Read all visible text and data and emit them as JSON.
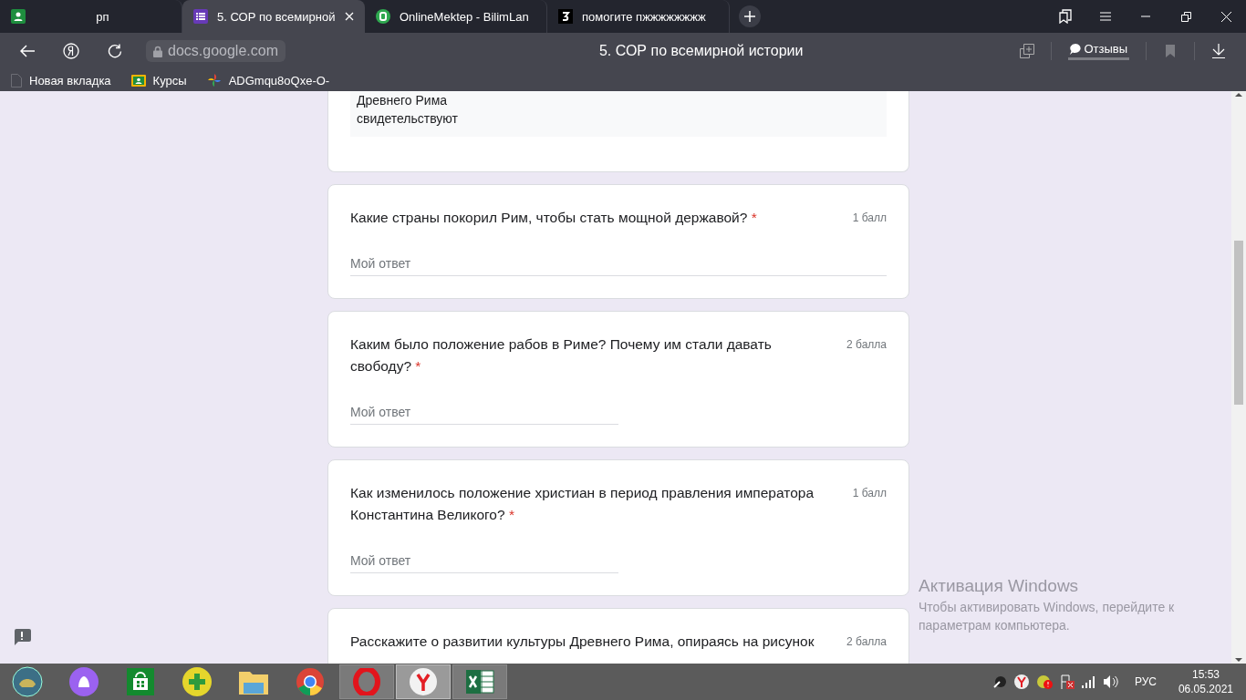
{
  "tabs": [
    {
      "title": "рп",
      "kind": "person",
      "selected": false
    },
    {
      "title": "5. СОР по всемирной",
      "kind": "list",
      "selected": true
    },
    {
      "title": "OnlineMektep - BilimLan",
      "kind": "greencircle",
      "selected": false
    },
    {
      "title": "помогите пжжжжжжжж",
      "kind": "blacksquare",
      "selected": false
    }
  ],
  "address": {
    "url": "docs.google.com",
    "page_title": "5. СОР по всемирной истории",
    "feedback": "Отзывы"
  },
  "bookmarks": [
    {
      "label": "Новая вкладка",
      "kind": "page"
    },
    {
      "label": "Курсы",
      "kind": "classroom"
    },
    {
      "label": "ADGmqu8oQxe-O-",
      "kind": "pinwheel"
    }
  ],
  "previous_answer": [
    "Древнего Рима",
    "свидетельствуют"
  ],
  "questions": [
    {
      "title": "Какие страны покорил Рим, чтобы стать мощной державой?",
      "required_mark": "*",
      "points": "1 балл",
      "placeholder": "Мой ответ",
      "kind": "wide"
    },
    {
      "title": "Каким было положение рабов в Риме? Почему им стали давать свободу?",
      "required_mark": "*",
      "points": "2 балла",
      "placeholder": "Мой ответ",
      "kind": "half"
    },
    {
      "title": "Как изменилось положение христиан в период правления императора Константина Великого?",
      "required_mark": "*",
      "points": "1 балл",
      "placeholder": "Мой ответ",
      "kind": "half"
    },
    {
      "title": "Расскажите о развитии культуры Древнего Рима, опираясь на рисунок",
      "points": "2 балла"
    }
  ],
  "activation": {
    "title": "Активация Windows",
    "text": "Чтобы активировать Windows, перейдите к параметрам компьютера."
  },
  "taskbar": {
    "apps": [
      {
        "kind": "start",
        "running": false,
        "selected": false
      },
      {
        "kind": "alice",
        "running": false,
        "selected": false
      },
      {
        "kind": "store",
        "running": false,
        "selected": false
      },
      {
        "kind": "plus",
        "running": false,
        "selected": false
      },
      {
        "kind": "folder",
        "running": false,
        "selected": false
      },
      {
        "kind": "chrome",
        "running": false,
        "selected": false
      },
      {
        "kind": "opera",
        "running": true,
        "selected": false
      },
      {
        "kind": "yandex",
        "running": true,
        "selected": true
      },
      {
        "kind": "excel",
        "running": true,
        "selected": false
      }
    ],
    "language": "РУС",
    "time": "15:53",
    "date": "06.05.2021"
  }
}
